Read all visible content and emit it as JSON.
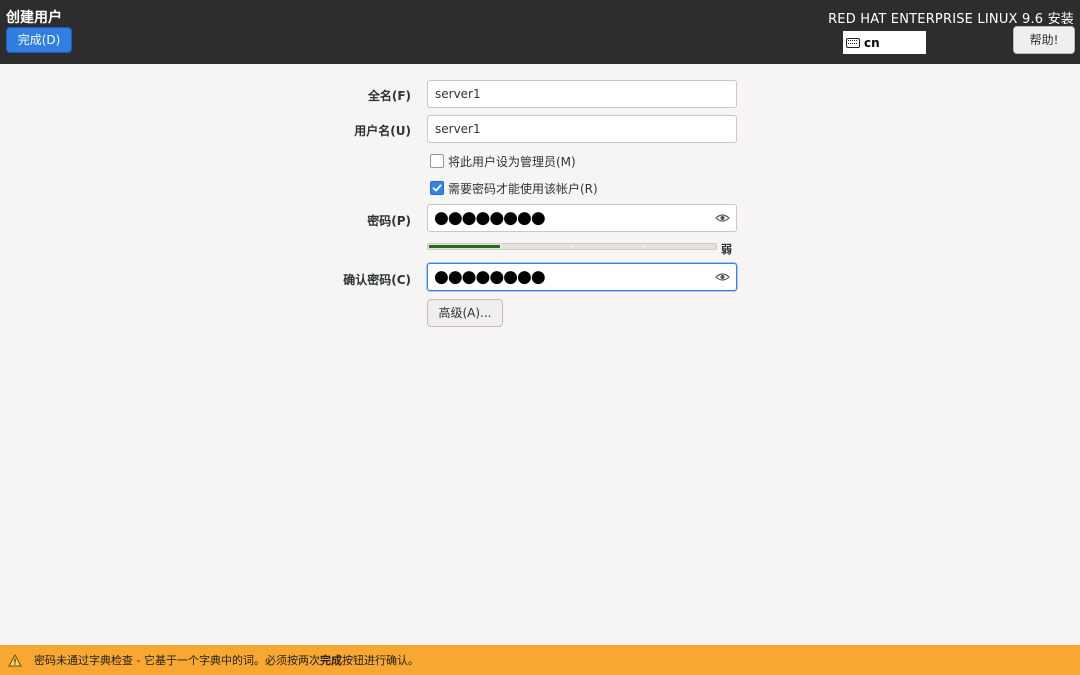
{
  "header": {
    "page_title": "创建用户",
    "done_label": "完成(D)",
    "product_title": "RED HAT ENTERPRISE LINUX 9.6 安装",
    "keyboard_layout": "cn",
    "help_label": "帮助!"
  },
  "form": {
    "fullname_label": "全名(F)",
    "fullname_value": "server1",
    "username_label": "用户名(U)",
    "username_value": "server1",
    "admin_checkbox_label": "将此用户设为管理员(M)",
    "admin_checked": false,
    "require_pw_label": "需要密码才能使用该帐户(R)",
    "require_pw_checked": true,
    "password_label": "密码(P)",
    "password_mask": "●●●●●●●●",
    "strength_fraction": 0.25,
    "strength_label": "弱",
    "confirm_label": "确认密码(C)",
    "confirm_mask": "●●●●●●●●",
    "advanced_label": "高级(A)..."
  },
  "warning": {
    "text_before": "密码未通过字典检查 - 它基于一个字典中的词。必须按两次",
    "text_bold": "完成",
    "text_after": "按钮进行确认。"
  },
  "colors": {
    "header_bg": "#2d2d2d",
    "primary_button": "#2f7ee0",
    "focus_border": "#3584e4",
    "strength_weak": "#1e6e1e",
    "warning_bg": "#f8a731"
  }
}
